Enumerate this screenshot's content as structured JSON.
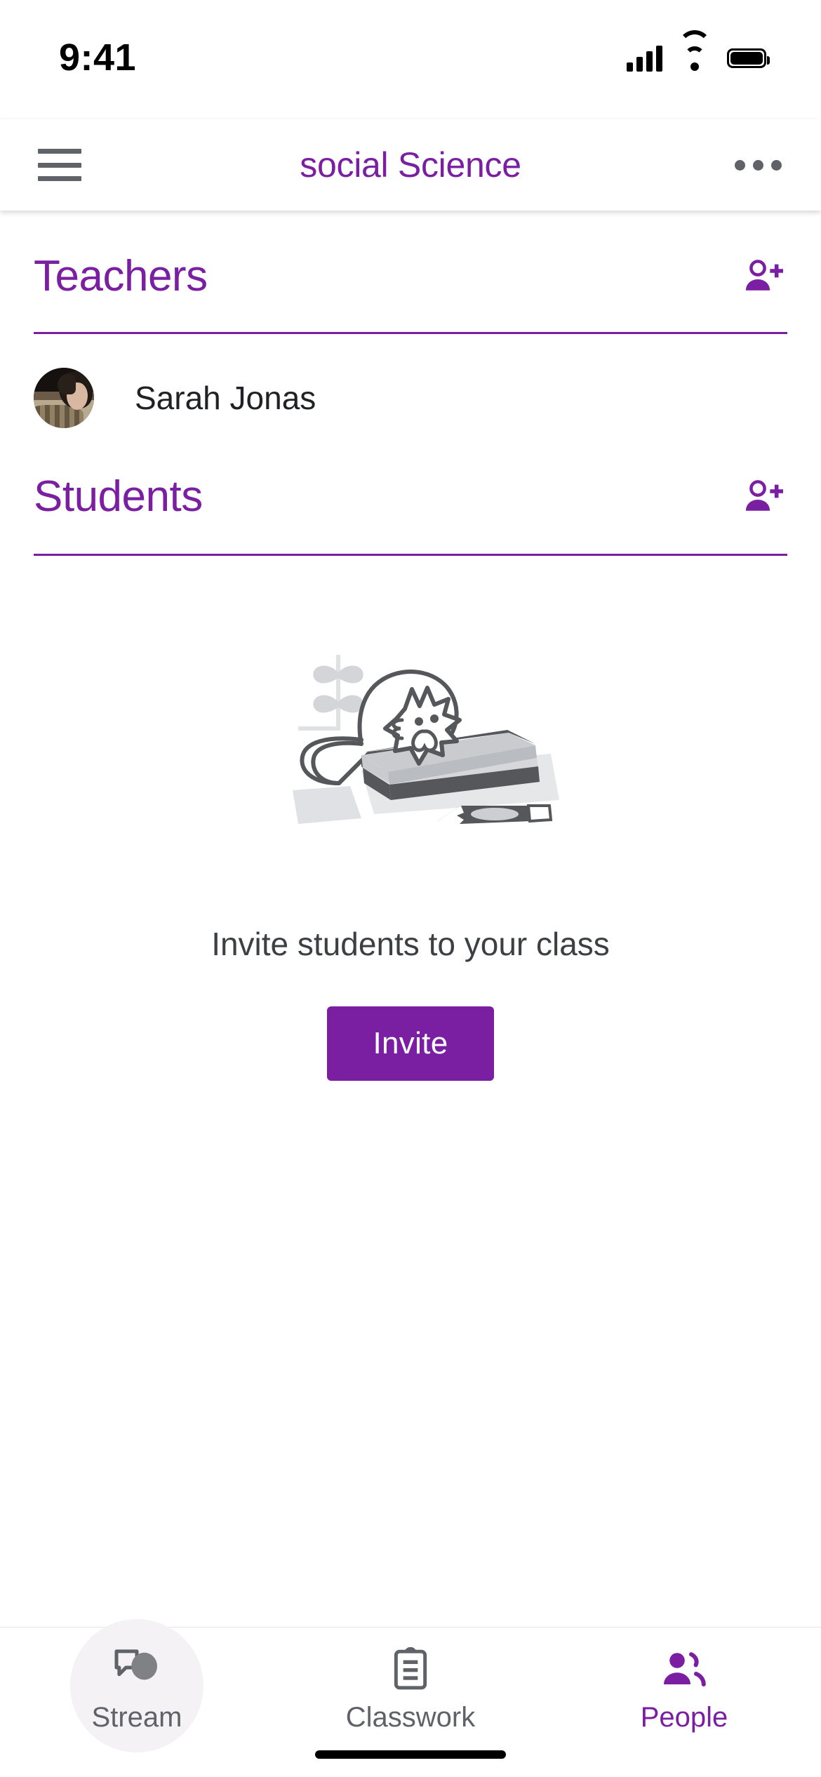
{
  "status_bar": {
    "time": "9:41",
    "icons": [
      "cellular-signal-icon",
      "wifi-icon",
      "battery-icon"
    ]
  },
  "app_bar": {
    "menu_icon": "hamburger-menu-icon",
    "title": "social Science",
    "overflow_icon": "more-options-icon",
    "title_color": "#7B1FA2"
  },
  "teachers": {
    "heading": "Teachers",
    "add_icon": "person-add-icon",
    "list": [
      {
        "name": "Sarah Jonas",
        "avatar": "teacher-photo"
      }
    ]
  },
  "students": {
    "heading": "Students",
    "add_icon": "person-add-icon",
    "empty_state": {
      "illustration": "cat-on-book-illustration",
      "message": "Invite students to your class",
      "button_label": "Invite",
      "button_color": "#7B1FA2"
    }
  },
  "bottom_nav": {
    "items": [
      {
        "label": "Stream",
        "icon": "stream-chat-icon",
        "active": false
      },
      {
        "label": "Classwork",
        "icon": "clipboard-icon",
        "active": false
      },
      {
        "label": "People",
        "icon": "people-icon",
        "active": true
      }
    ],
    "active_color": "#7B1FA2",
    "inactive_color": "#5f6368"
  },
  "home_indicator": "home-indicator-bar"
}
